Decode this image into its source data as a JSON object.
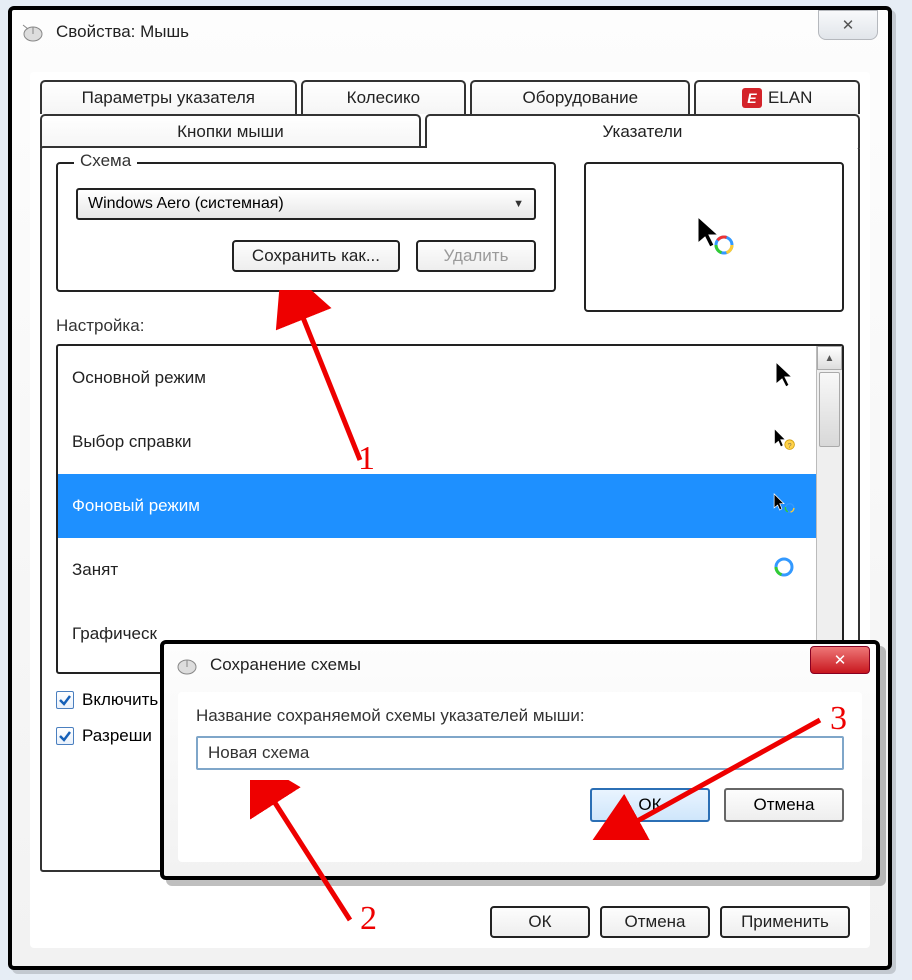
{
  "window": {
    "title": "Свойства: Мышь",
    "close_glyph": "✕"
  },
  "tabs": {
    "row1": [
      {
        "label": "Параметры указателя"
      },
      {
        "label": "Колесико"
      },
      {
        "label": "Оборудование"
      },
      {
        "label": "ELAN",
        "icon": "E"
      }
    ],
    "row2": [
      {
        "label": "Кнопки мыши"
      },
      {
        "label": "Указатели",
        "active": true
      }
    ]
  },
  "scheme": {
    "group_label": "Схема",
    "selected": "Windows Aero (системная)",
    "save_as_label": "Сохранить как...",
    "delete_label": "Удалить"
  },
  "settings_label": "Настройка:",
  "cursor_list": [
    {
      "label": "Основной режим",
      "icon": "arrow"
    },
    {
      "label": "Выбор справки",
      "icon": "arrow-help"
    },
    {
      "label": "Фоновый режим",
      "icon": "arrow-busy",
      "selected": true
    },
    {
      "label": "Занят",
      "icon": "busy"
    },
    {
      "label": "Графическ",
      "icon": "cross"
    }
  ],
  "checkboxes": {
    "enable": "Включить",
    "allow": "Разреши"
  },
  "bottom_buttons": {
    "ok": "ОК",
    "cancel": "Отмена",
    "apply": "Применить"
  },
  "dialog": {
    "title": "Сохранение схемы",
    "label": "Название сохраняемой схемы указателей мыши:",
    "value": "Новая схема",
    "ok": "ОК",
    "cancel": "Отмена",
    "close_glyph": "✕"
  },
  "annotations": {
    "n1": "1",
    "n2": "2",
    "n3": "3"
  }
}
